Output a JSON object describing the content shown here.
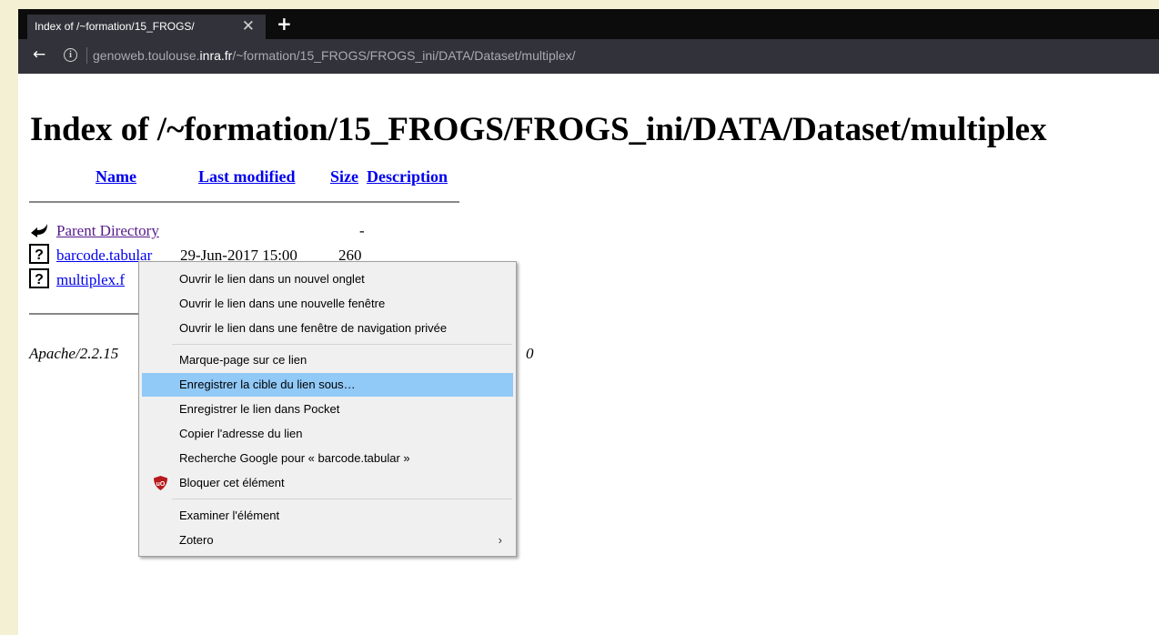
{
  "browser": {
    "tab_title": "Index of /~formation/15_FROGS/",
    "tab_close": "✕",
    "new_tab": "+",
    "back": "←",
    "url_prefix": "genoweb.toulouse.",
    "url_host": "inra.fr",
    "url_path": "/~formation/15_FROGS/FROGS_ini/DATA/Dataset/multiplex/"
  },
  "page": {
    "title": "Index of /~formation/15_FROGS/FROGS_ini/DATA/Dataset/multiplex",
    "columns": {
      "name": "Name",
      "last_modified": "Last modified",
      "size": "Size",
      "description": "Description"
    },
    "rows": [
      {
        "name": "Parent Directory",
        "modified": "",
        "size": "-",
        "icon": "back-icon"
      },
      {
        "name": "barcode.tabular",
        "modified": "29-Jun-2017 15:00",
        "size": "260",
        "icon": "unknown-file-icon"
      },
      {
        "name": "multiplex.f",
        "modified": "",
        "size": "",
        "icon": "unknown-file-icon"
      }
    ],
    "address_visible": "Apache/2.2.15",
    "address_tail": "0"
  },
  "context_menu": {
    "items": [
      {
        "label": "Ouvrir le lien dans un nouvel onglet"
      },
      {
        "label": "Ouvrir le lien dans une nouvelle fenêtre"
      },
      {
        "label": "Ouvrir le lien dans une fenêtre de navigation privée"
      },
      {
        "label": "Marque-page sur ce lien"
      },
      {
        "label": "Enregistrer la cible du lien sous…"
      },
      {
        "label": "Enregistrer le lien dans Pocket"
      },
      {
        "label": "Copier l'adresse du lien"
      },
      {
        "label": "Recherche Google pour « barcode.tabular »"
      },
      {
        "label": "Bloquer cet élément"
      },
      {
        "label": "Examiner l'élément"
      },
      {
        "label": "Zotero"
      }
    ],
    "highlighted_index": 4,
    "submenu_arrow": "›",
    "highlight_color": "#91c9f7"
  }
}
